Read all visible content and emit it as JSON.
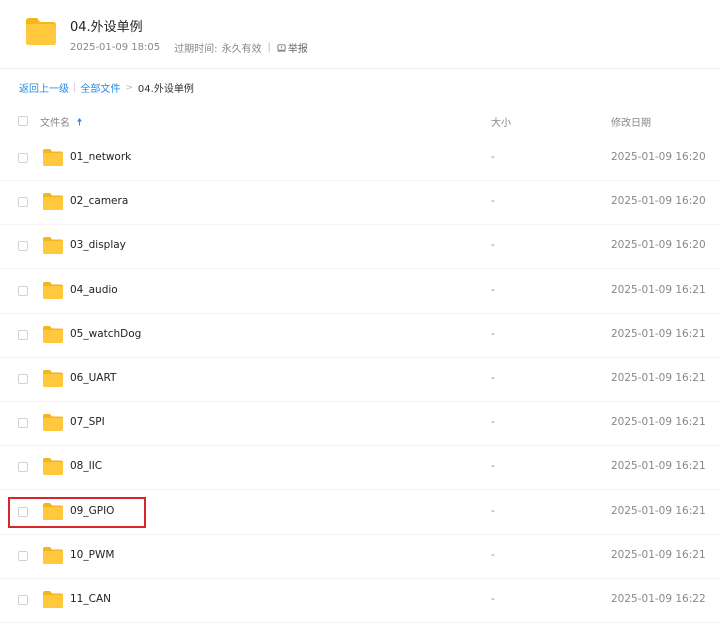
{
  "header": {
    "title": "04.外设单例",
    "date": "2025-01-09 18:05",
    "expire_label": "过期时间:",
    "expire_value": "永久有效",
    "report_label": "举报",
    "folder_icon": "folder-icon"
  },
  "breadcrumb": {
    "back": "返回上一级",
    "all_files": "全部文件",
    "current": "04.外设单例"
  },
  "table": {
    "col_name": "文件名",
    "col_size": "大小",
    "col_date": "修改日期",
    "rows": [
      {
        "name": "01_network",
        "size": "-",
        "date": "2025-01-09 16:20"
      },
      {
        "name": "02_camera",
        "size": "-",
        "date": "2025-01-09 16:20"
      },
      {
        "name": "03_display",
        "size": "-",
        "date": "2025-01-09 16:20"
      },
      {
        "name": "04_audio",
        "size": "-",
        "date": "2025-01-09 16:21"
      },
      {
        "name": "05_watchDog",
        "size": "-",
        "date": "2025-01-09 16:21"
      },
      {
        "name": "06_UART",
        "size": "-",
        "date": "2025-01-09 16:21"
      },
      {
        "name": "07_SPI",
        "size": "-",
        "date": "2025-01-09 16:21"
      },
      {
        "name": "08_IIC",
        "size": "-",
        "date": "2025-01-09 16:21"
      },
      {
        "name": "09_GPIO",
        "size": "-",
        "date": "2025-01-09 16:21"
      },
      {
        "name": "10_PWM",
        "size": "-",
        "date": "2025-01-09 16:21"
      },
      {
        "name": "11_CAN",
        "size": "-",
        "date": "2025-01-09 16:22"
      }
    ]
  },
  "colors": {
    "folder": "#ffc83d",
    "folder_dark": "#f4b61c",
    "link": "#2a8ae6",
    "highlight": "#d9262b"
  }
}
